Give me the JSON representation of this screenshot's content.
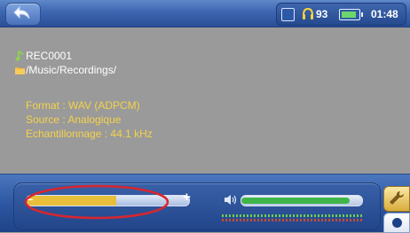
{
  "status_bar": {
    "volume": "93",
    "clock": "01:48",
    "battery_level": 0.85
  },
  "recording": {
    "file_name": "REC0001",
    "folder_path": "/Music/Recordings/",
    "info_lines": [
      "Format : WAV (ADPCM)",
      "Source : Analogique",
      "Echantillonnage : 44.1 kHz"
    ]
  },
  "controls": {
    "progress_minus": "–",
    "progress_plus": "+",
    "progress_level": 0.55,
    "volume_level": 0.9
  },
  "colors": {
    "info_text": "#f5d24a",
    "progress_fill": "#e8bf3a",
    "volume_fill": "#3fb64a",
    "annotation": "#d8262e",
    "bar_blue": "#2d57a2"
  },
  "icons": {
    "back": "back-arrow-icon",
    "hold": "hold-lock-icon",
    "headphone": "headphone-icon",
    "battery": "battery-icon",
    "note": "music-note-icon",
    "folder": "folder-icon",
    "speaker": "speaker-icon",
    "tools": "wrench-icon",
    "record": "record-dot-icon"
  }
}
